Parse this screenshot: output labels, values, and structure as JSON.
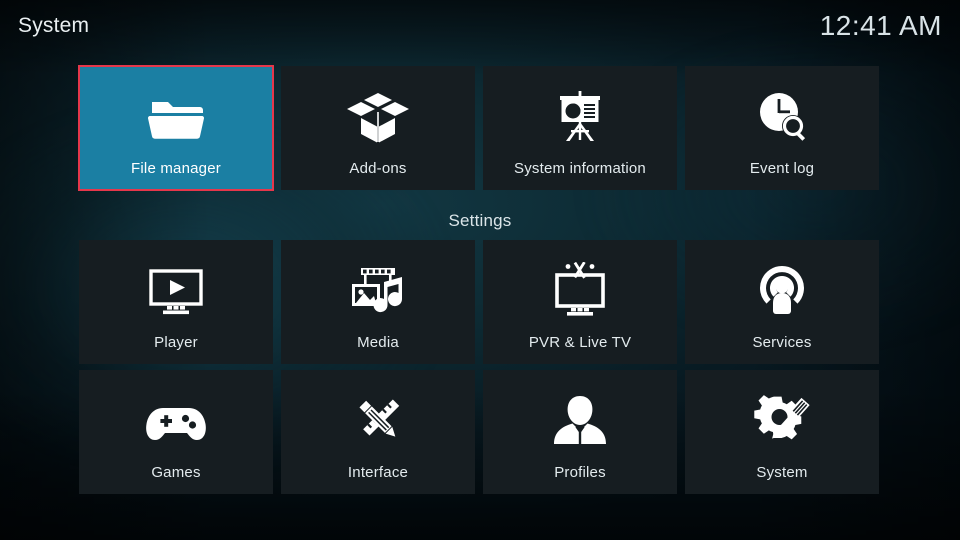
{
  "header": {
    "title": "System",
    "clock": "12:41 AM"
  },
  "sections": {
    "settings_heading": "Settings"
  },
  "colors": {
    "selected_tile_bg": "#1b7fa3",
    "selection_border": "#e5374b",
    "tile_bg": "#161d21",
    "text": "#e3ebee",
    "background": "#0d2a33"
  },
  "top_row": [
    {
      "label": "File manager",
      "icon": "folder-icon",
      "selected": true
    },
    {
      "label": "Add-ons",
      "icon": "open-box-icon",
      "selected": false
    },
    {
      "label": "System information",
      "icon": "presentation-board-icon",
      "selected": false
    },
    {
      "label": "Event log",
      "icon": "clock-search-icon",
      "selected": false
    }
  ],
  "settings_row_1": [
    {
      "label": "Player",
      "icon": "monitor-play-icon",
      "selected": false
    },
    {
      "label": "Media",
      "icon": "media-library-icon",
      "selected": false
    },
    {
      "label": "PVR & Live TV",
      "icon": "tv-antenna-icon",
      "selected": false
    },
    {
      "label": "Services",
      "icon": "broadcast-user-icon",
      "selected": false
    }
  ],
  "settings_row_2": [
    {
      "label": "Games",
      "icon": "gamepad-icon",
      "selected": false
    },
    {
      "label": "Interface",
      "icon": "pencil-ruler-icon",
      "selected": false
    },
    {
      "label": "Profiles",
      "icon": "person-bust-icon",
      "selected": false
    },
    {
      "label": "System",
      "icon": "gear-wrench-icon",
      "selected": false
    }
  ]
}
